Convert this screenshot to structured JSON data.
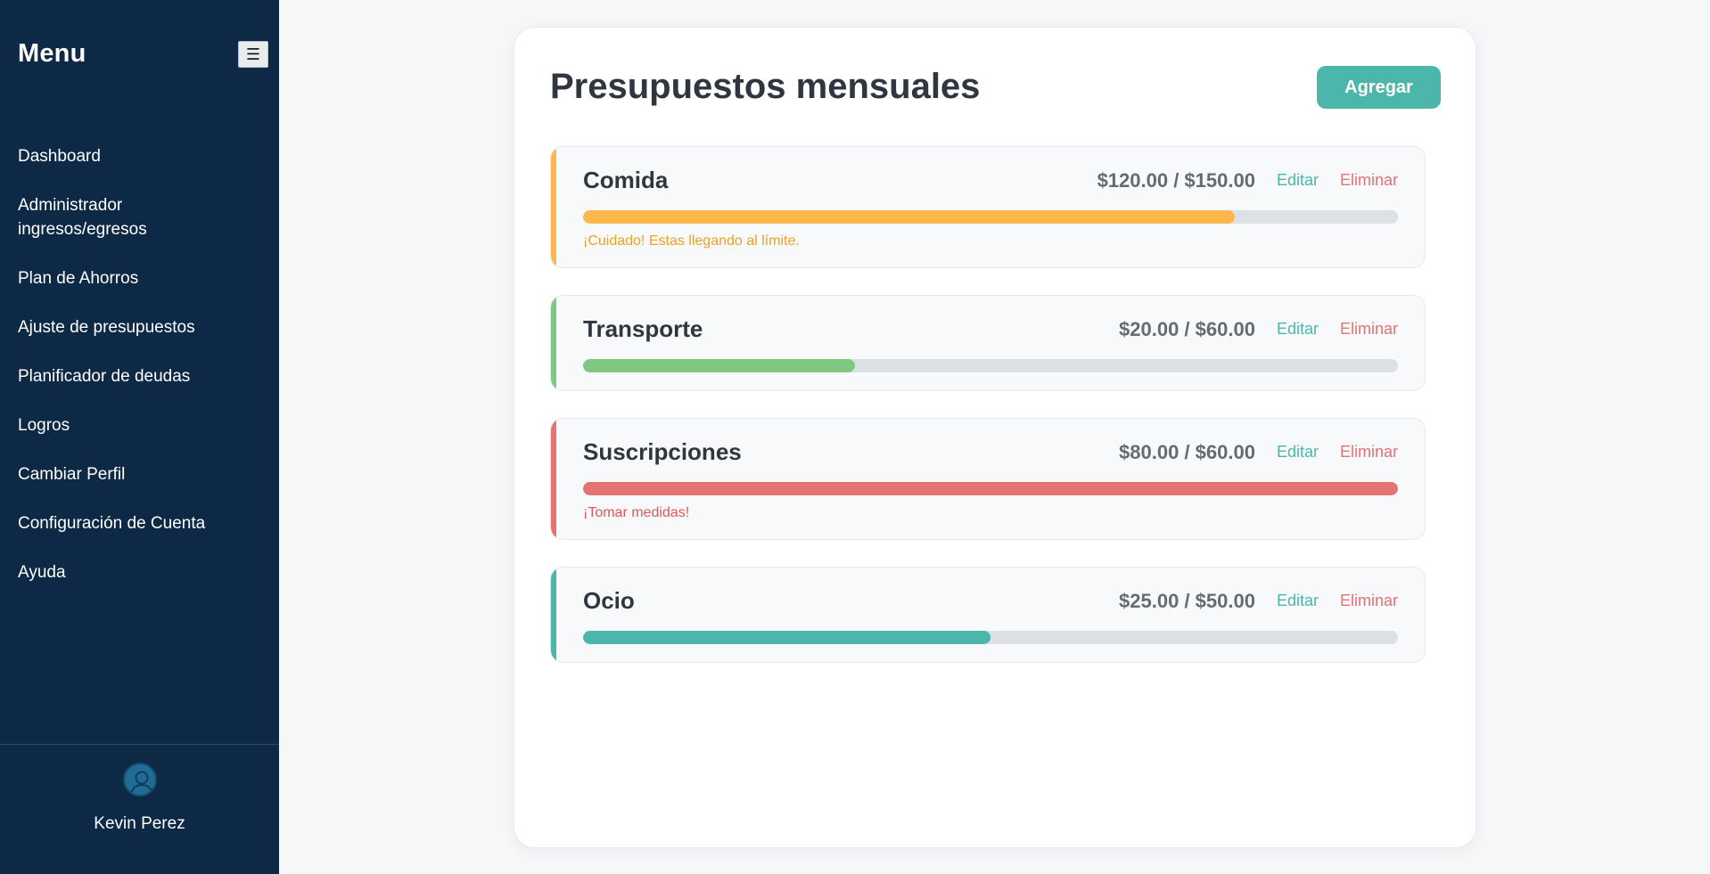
{
  "colors": {
    "sidebar_bg": "#0d2945",
    "accent_teal": "#4db6aa",
    "warning_orange": "#ffb74d",
    "success_green": "#81c784",
    "danger_red": "#e57373"
  },
  "sidebar": {
    "title": "Menu",
    "toggle_icon": "hamburger-icon",
    "toggle_glyph": "☰",
    "items": [
      {
        "label": "Dashboard"
      },
      {
        "label": "Administrador ingresos/egresos"
      },
      {
        "label": "Plan de Ahorros"
      },
      {
        "label": "Ajuste de presupuestos"
      },
      {
        "label": "Planificador de deudas"
      },
      {
        "label": "Logros"
      },
      {
        "label": "Cambiar Perfil"
      },
      {
        "label": "Configuración de Cuenta"
      },
      {
        "label": "Ayuda"
      }
    ],
    "user": {
      "avatar_icon": "user-icon",
      "name": "Kevin Perez"
    }
  },
  "main": {
    "title": "Presupuestos mensuales",
    "add_label": "Agregar",
    "budgets": [
      {
        "name": "Comida",
        "amount": "$120.00 / $150.00",
        "progress": 0.8,
        "color": "#ffb74d",
        "warning": "¡Cuidado! Estas llegando al límite.",
        "warning_color": "#f0a020",
        "edit": "Editar",
        "delete": "Eliminar"
      },
      {
        "name": "Transporte",
        "amount": "$20.00 / $60.00",
        "progress": 0.3333,
        "color": "#81c784",
        "warning": "",
        "warning_color": "",
        "edit": "Editar",
        "delete": "Eliminar"
      },
      {
        "name": "Suscripciones",
        "amount": "$80.00 / $60.00",
        "progress": 1.0,
        "color": "#e57373",
        "warning": "¡Tomar medidas!",
        "warning_color": "#e05757",
        "edit": "Editar",
        "delete": "Eliminar"
      },
      {
        "name": "Ocio",
        "amount": "$25.00 / $50.00",
        "progress": 0.5,
        "color": "#4db6aa",
        "warning": "",
        "warning_color": "",
        "edit": "Editar",
        "delete": "Eliminar"
      }
    ]
  }
}
